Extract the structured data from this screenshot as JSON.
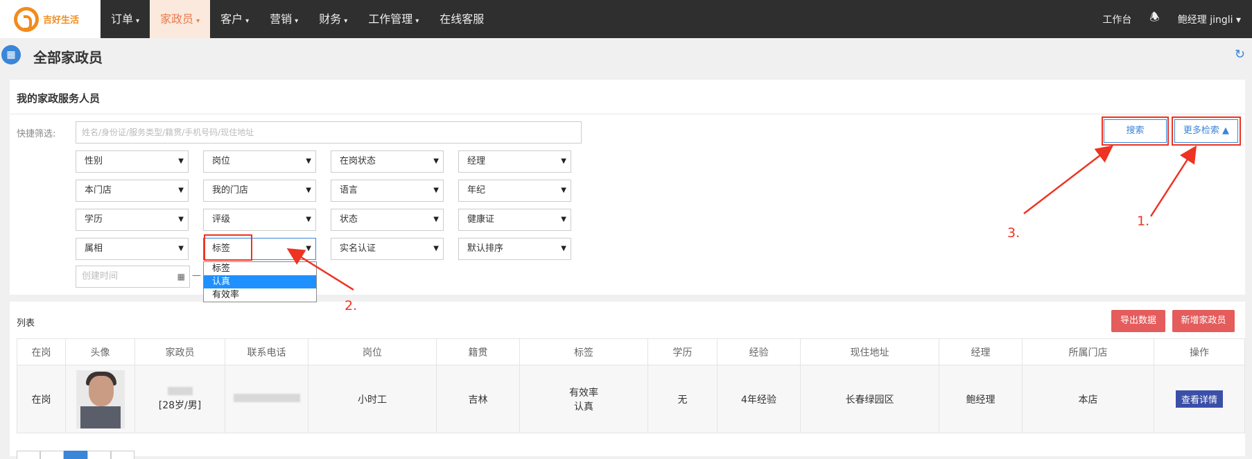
{
  "header": {
    "brand": "吉好生活",
    "nav": [
      {
        "label": "订单",
        "caret": "▾"
      },
      {
        "label": "家政员",
        "caret": "▾",
        "active": true
      },
      {
        "label": "客户",
        "caret": "▾"
      },
      {
        "label": "营销",
        "caret": "▾"
      },
      {
        "label": "财务",
        "caret": "▾"
      },
      {
        "label": "工作管理",
        "caret": "▾"
      },
      {
        "label": "在线客服",
        "caret": ""
      }
    ],
    "workbench": "工作台",
    "user": "鲍经理 jingli ▾"
  },
  "page": {
    "title": "全部家政员"
  },
  "filter_panel": {
    "title": "我的家政服务人员",
    "quick_label": "快捷筛选:",
    "search_placeholder": "姓名/身份证/服务类型/籍贯/手机号码/现住地址",
    "selects": [
      "性别",
      "岗位",
      "在岗状态",
      "经理",
      "本门店",
      "我的门店",
      "语言",
      "年纪",
      "学历",
      "评级",
      "状态",
      "健康证",
      "属相",
      "标签",
      "实名认证",
      "默认排序"
    ],
    "date_placeholder": "创建时间",
    "date_dash": "—",
    "tag_dropdown": {
      "options": [
        "标签",
        "认真",
        "有效率"
      ],
      "highlighted": "认真"
    },
    "search_button": "搜索",
    "more_button": "更多检索 ▲"
  },
  "annotations": {
    "one": "1.",
    "two": "2.",
    "three": "3."
  },
  "list_panel": {
    "title": "列表",
    "export_button": "导出数据",
    "add_button": "新增家政员",
    "columns": [
      "在岗",
      "头像",
      "家政员",
      "联系电话",
      "岗位",
      "籍贯",
      "标签",
      "学历",
      "经验",
      "现住地址",
      "经理",
      "所属门店",
      "操作"
    ],
    "rows": [
      {
        "status": "在岗",
        "age_gender": "[28岁/男]",
        "position": "小时工",
        "origin": "吉林",
        "tag1": "有效率",
        "tag2": "认真",
        "education": "无",
        "experience": "4年经验",
        "address": "长春绿园区",
        "manager": "鲍经理",
        "store": "本店",
        "action": "查看详情"
      }
    ]
  },
  "colors": {
    "accent": "#3a86d8",
    "brand_orange": "#f08c1e",
    "annotation_red": "#ee3322",
    "danger_button": "#e45c5c"
  }
}
